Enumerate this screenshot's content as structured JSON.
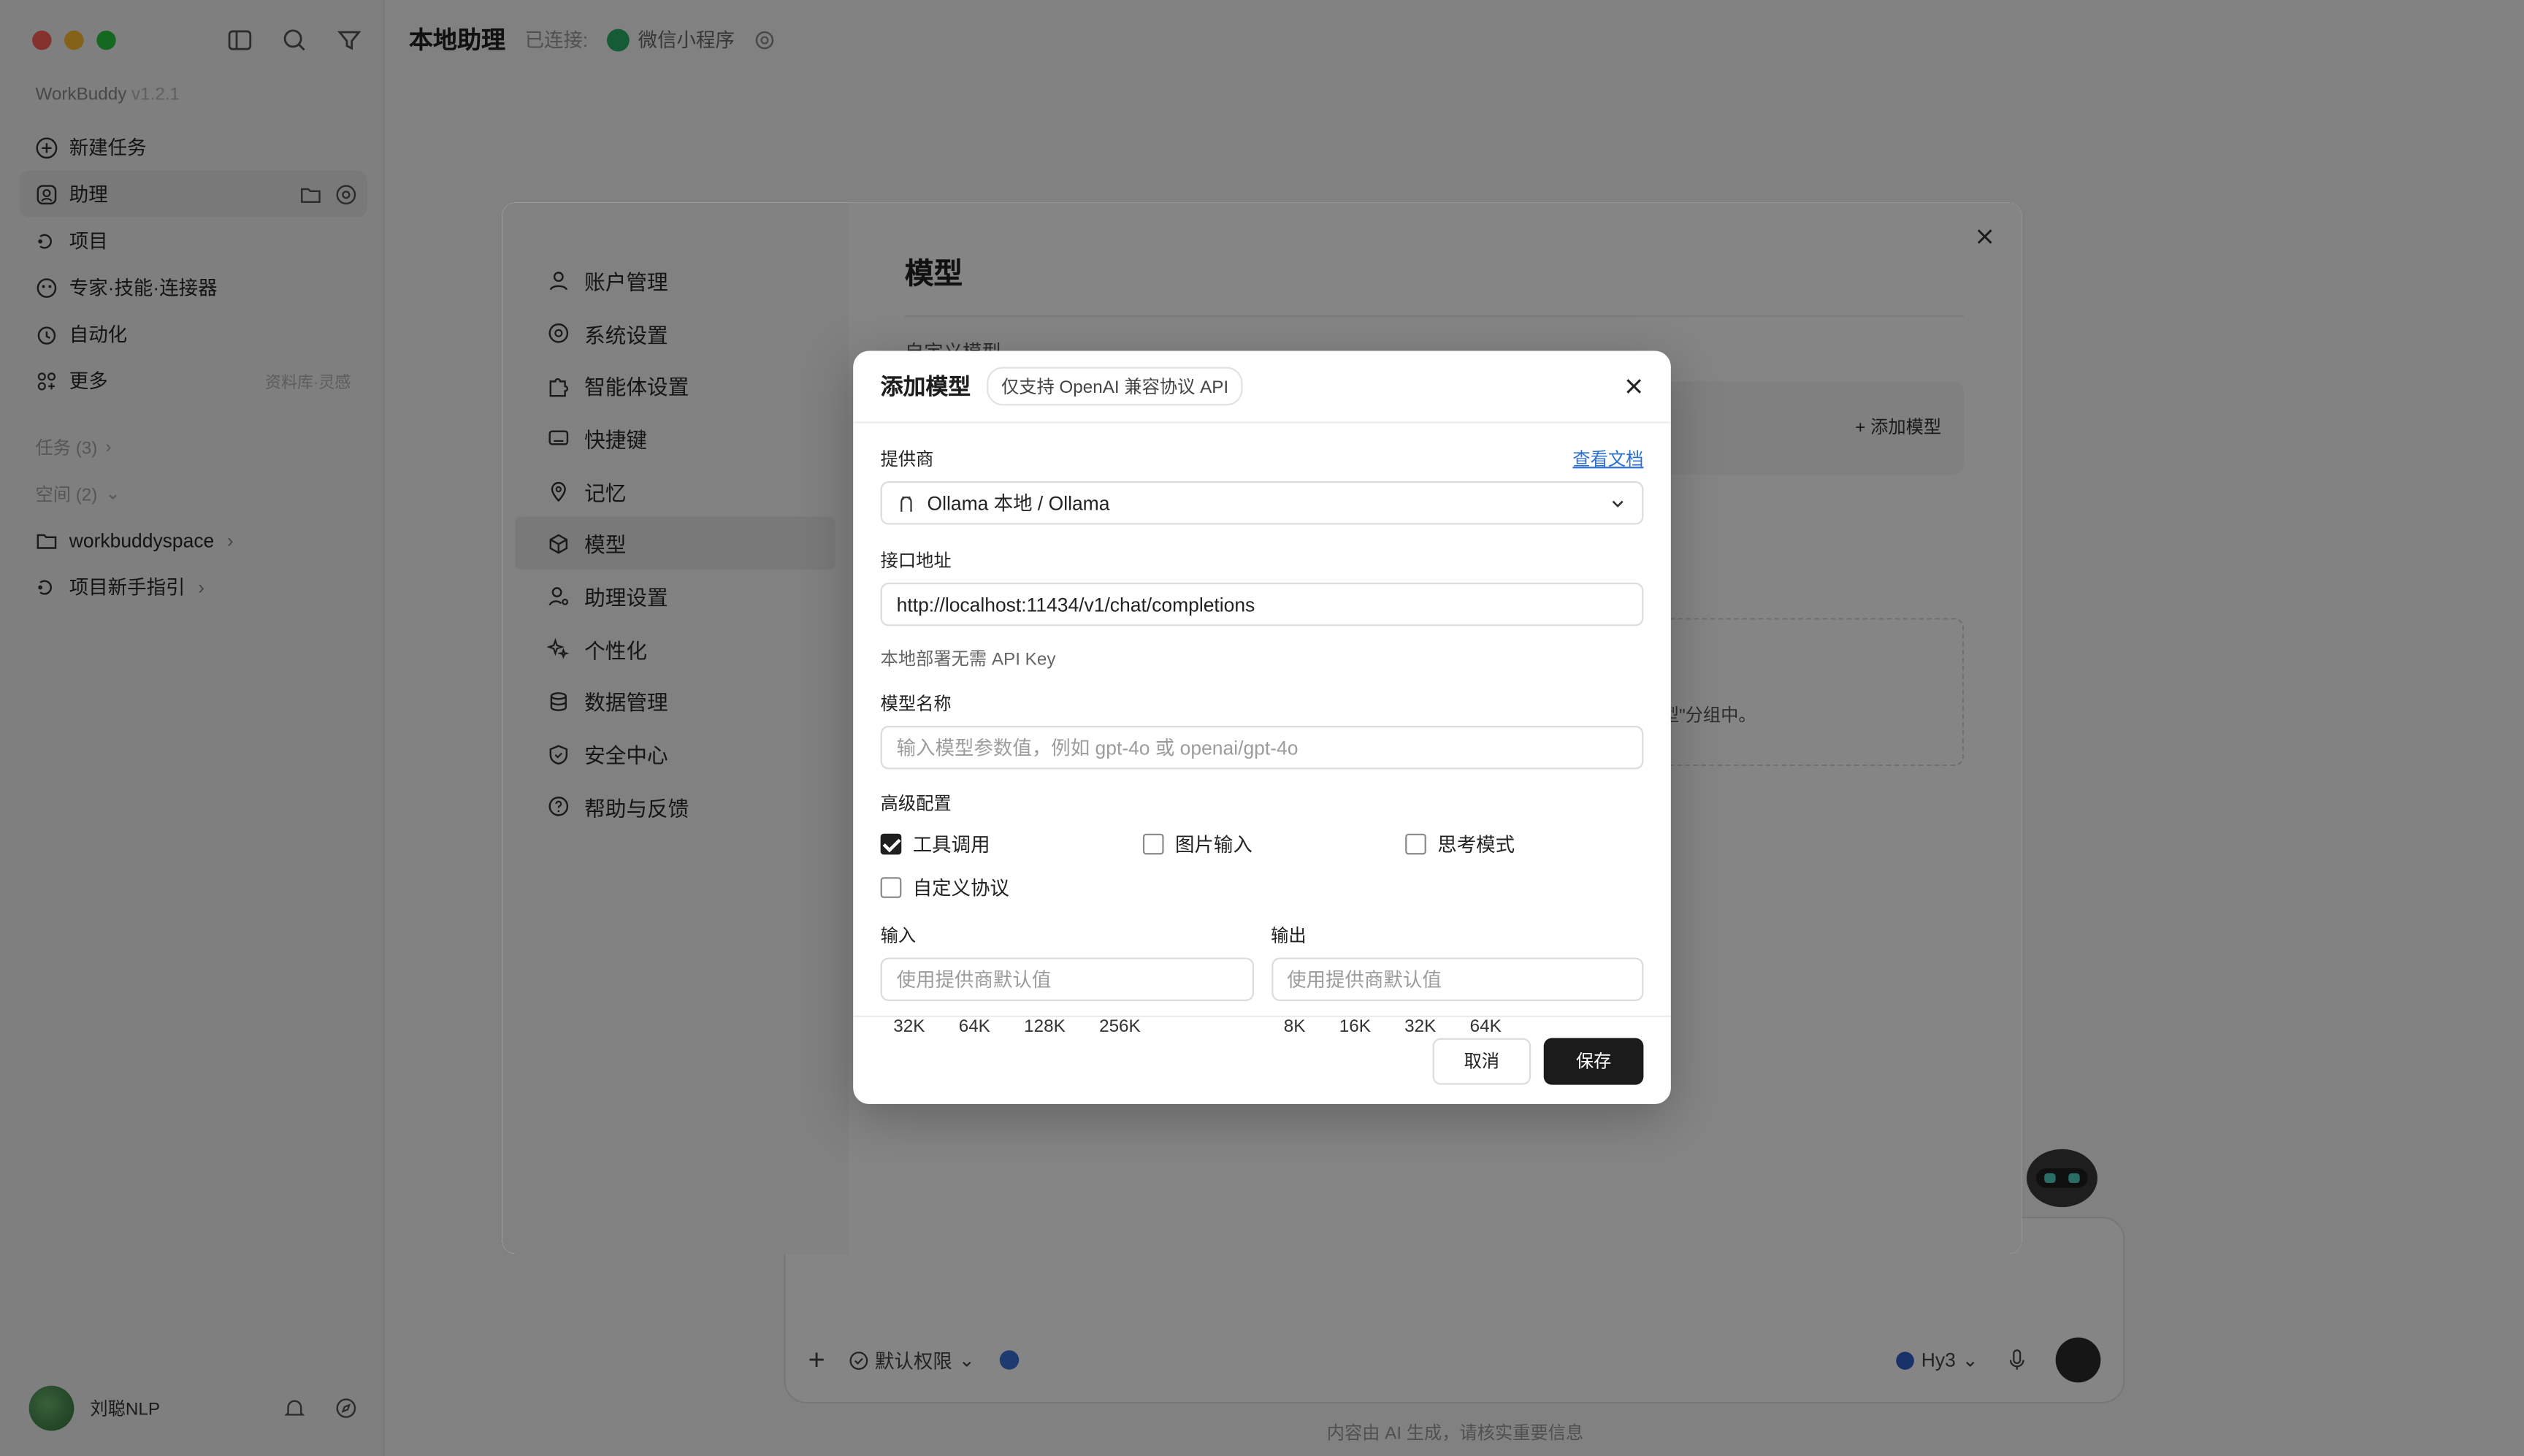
{
  "window": {
    "brand": "WorkBuddy",
    "version": "v1.2.1"
  },
  "sidebar": {
    "items": [
      {
        "label": "新建任务"
      },
      {
        "label": "助理"
      },
      {
        "label": "项目"
      },
      {
        "label": "专家·技能·连接器"
      },
      {
        "label": "自动化"
      },
      {
        "label": "更多",
        "hint": "资料库·灵感"
      }
    ],
    "tasks_label": "任务 (3)",
    "spaces_label": "空间 (2)",
    "spaces": [
      {
        "label": "workbuddyspace"
      },
      {
        "label": "项目新手指引"
      }
    ],
    "user": {
      "name": "刘聪NLP"
    }
  },
  "header": {
    "title": "本地助理",
    "connected": "已连接:",
    "channel": "微信小程序"
  },
  "composer": {
    "permission": "默认权限",
    "model": "Hy3"
  },
  "footer_note": "内容由 AI 生成，请核实重要信息",
  "settings": {
    "nav": [
      {
        "label": "账户管理"
      },
      {
        "label": "系统设置"
      },
      {
        "label": "智能体设置"
      },
      {
        "label": "快捷键"
      },
      {
        "label": "记忆"
      },
      {
        "label": "模型"
      },
      {
        "label": "助理设置"
      },
      {
        "label": "个性化"
      },
      {
        "label": "数据管理"
      },
      {
        "label": "安全中心"
      },
      {
        "label": "帮助与反馈"
      }
    ],
    "title": "模型",
    "custom_label": "自定义模型",
    "add_model": "+ 添加模型",
    "dashed_hint": "型\"分组中。"
  },
  "dialog": {
    "title": "添加模型",
    "tag": "仅支持 OpenAI 兼容协议 API",
    "provider_label": "提供商",
    "doc_link": "查看文档",
    "provider_value": "Ollama 本地 / Ollama",
    "endpoint_label": "接口地址",
    "endpoint_value": "http://localhost:11434/v1/chat/completions",
    "apikey_note": "本地部署无需 API Key",
    "model_name_label": "模型名称",
    "model_name_placeholder": "输入模型参数值，例如 gpt-4o 或 openai/gpt-4o",
    "advanced_label": "高级配置",
    "checks": [
      {
        "label": "工具调用",
        "checked": true
      },
      {
        "label": "图片输入",
        "checked": false
      },
      {
        "label": "思考模式",
        "checked": false
      },
      {
        "label": "自定义协议",
        "checked": false
      }
    ],
    "input_label": "输入",
    "output_label": "输出",
    "io_placeholder": "使用提供商默认值",
    "input_chips": [
      "32K",
      "64K",
      "128K",
      "256K"
    ],
    "output_chips": [
      "8K",
      "16K",
      "32K",
      "64K"
    ],
    "cancel": "取消",
    "save": "保存"
  }
}
